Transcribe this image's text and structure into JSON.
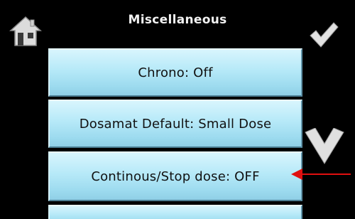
{
  "header": {
    "title": "Miscellaneous"
  },
  "icons": {
    "home": "home-icon",
    "confirm": "checkmark-icon",
    "scroll_down": "chevron-down-icon"
  },
  "menu": {
    "items": [
      {
        "label": "Chrono: Off"
      },
      {
        "label": "Dosamat Default: Small Dose"
      },
      {
        "label": "Continous/Stop dose: OFF"
      },
      {
        "label": ""
      }
    ]
  },
  "annotation": {
    "arrow_color": "#e01010"
  },
  "colors": {
    "background": "#000000",
    "button_top": "#d8f5fd",
    "button_bottom": "#8fcfe6",
    "icon_light": "#e6e6e6"
  }
}
